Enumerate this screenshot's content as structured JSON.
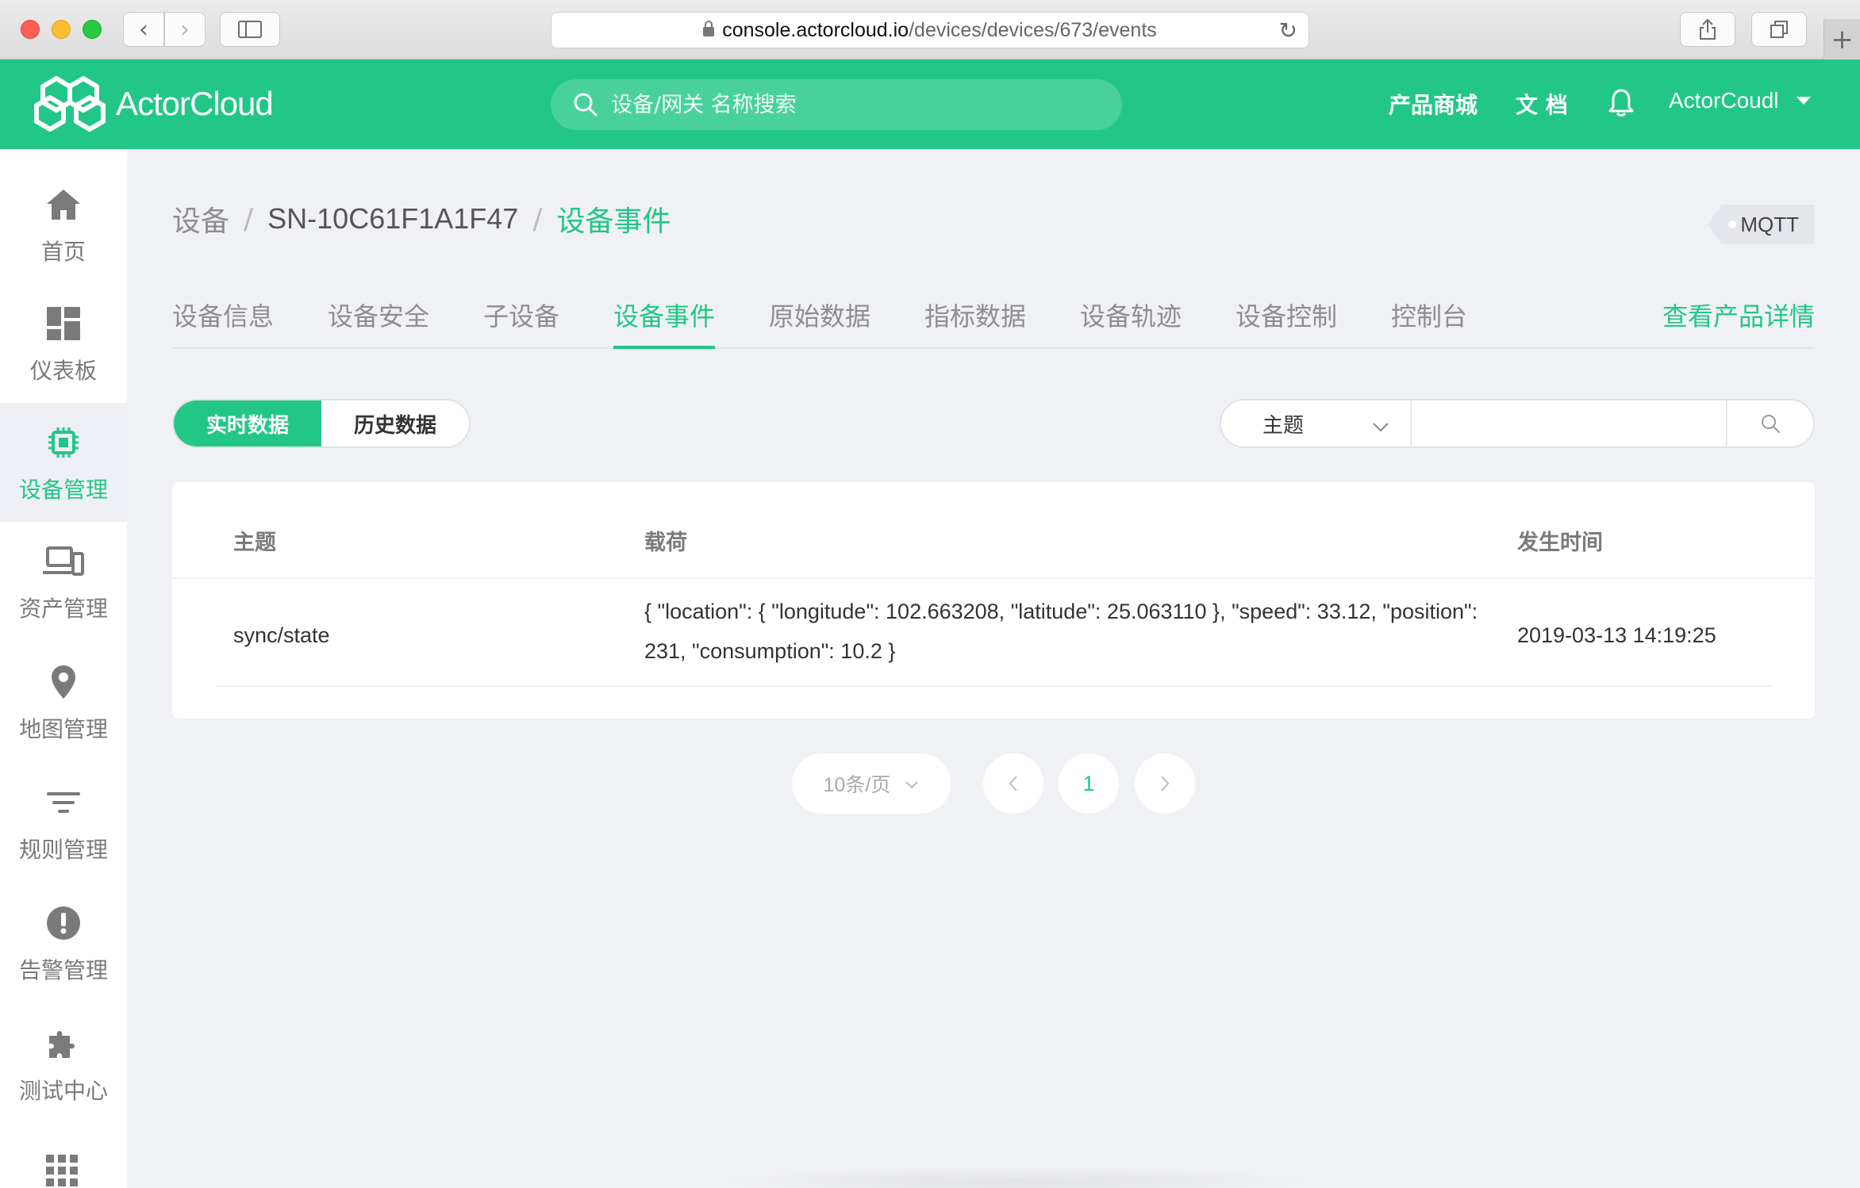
{
  "browser": {
    "url_domain": "console.actorcloud.io",
    "url_path": "/devices/devices/673/events"
  },
  "header": {
    "logo_text": "ActorCloud",
    "search_placeholder": "设备/网关 名称搜索",
    "shop_label": "产品商城",
    "docs_label": "文 档",
    "username": "ActorCoudl"
  },
  "sidebar": {
    "items": [
      {
        "label": "首页",
        "icon": "home-icon"
      },
      {
        "label": "仪表板",
        "icon": "dashboard-icon"
      },
      {
        "label": "设备管理",
        "icon": "chip-icon",
        "active": true
      },
      {
        "label": "资产管理",
        "icon": "devices-icon"
      },
      {
        "label": "地图管理",
        "icon": "map-pin-icon"
      },
      {
        "label": "规则管理",
        "icon": "filter-icon"
      },
      {
        "label": "告警管理",
        "icon": "alert-icon"
      },
      {
        "label": "测试中心",
        "icon": "puzzle-icon"
      }
    ]
  },
  "breadcrumb": {
    "root": "设备",
    "device": "SN-10C61F1A1F47",
    "current": "设备事件"
  },
  "protocol_badge": "MQTT",
  "tabs": [
    {
      "label": "设备信息"
    },
    {
      "label": "设备安全"
    },
    {
      "label": "子设备"
    },
    {
      "label": "设备事件",
      "active": true
    },
    {
      "label": "原始数据"
    },
    {
      "label": "指标数据"
    },
    {
      "label": "设备轨迹"
    },
    {
      "label": "设备控制"
    },
    {
      "label": "控制台"
    }
  ],
  "product_detail_link": "查看产品详情",
  "data_mode": {
    "realtime": "实时数据",
    "history": "历史数据"
  },
  "filter": {
    "field": "主题",
    "value": ""
  },
  "table": {
    "headers": [
      "主题",
      "载荷",
      "发生时间"
    ],
    "rows": [
      {
        "topic": "sync/state",
        "payload": "{ \"location\": { \"longitude\": 102.663208, \"latitude\": 25.063110 }, \"speed\": 33.12, \"position\": 231, \"consumption\":   10.2 }",
        "time": "2019-03-13 14:19:25"
      }
    ]
  },
  "pagination": {
    "page_size": "10条/页",
    "current_page": "1"
  },
  "colors": {
    "brand": "#22c787",
    "background": "#f0f1f5"
  }
}
